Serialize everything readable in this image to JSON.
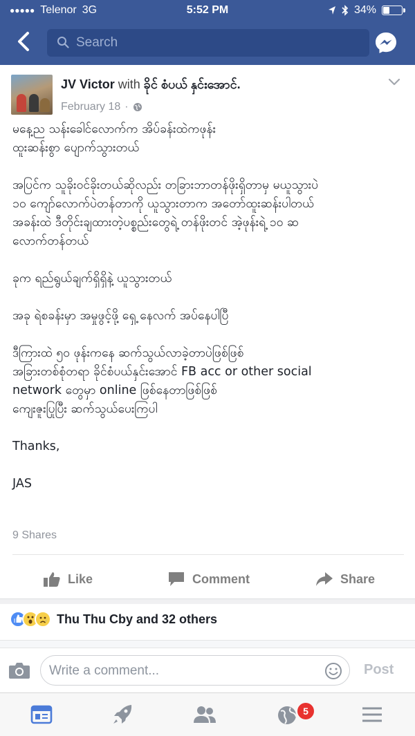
{
  "status_bar": {
    "signal_dots": "●●●●●",
    "carrier": "Telenor",
    "network": "3G",
    "time": "5:52 PM",
    "battery_percent": "34%",
    "battery_level": 0.34
  },
  "nav": {
    "search_placeholder": "Search"
  },
  "post": {
    "author": "JV Victor",
    "with_text": "with",
    "tagged": "ခိုင် စံပယ် နှင်းအောင်.",
    "date": "February 18",
    "date_separator": "·",
    "paragraphs": [
      [
        "မနေ့ည သန်းခေါင်လောက်က အိပ်ခန်းထဲကဖုန်း",
        "ထူးဆန်းစွာ ပျောက်သွားတယ်"
      ],
      [
        "အပြင်က သူခိုးဝင်ခိုးတယ်ဆိုလည်း တခြားဘာတန်ဖိုးရှိတာမှ မယူသွားပဲ",
        "၁၀ ကျော်လောက်ပဲတန်တာကို ယူသွားတာက အတော်ထူးဆန်းပါတယ်",
        "အခန်းထဲ ဒီတိုင်းချထားတဲ့ပစ္စည်းတွေရဲ့ တန်ဖိုးတင် အဲ့ဖုန်းရဲ့ ၁၀ ဆ",
        "လောက်တန်တယ်"
      ],
      [
        "ခုက ရည်ရွယ်ချက်ရှိရှိနဲ့ ယူသွားတယ်"
      ],
      [
        "အခု ရဲစခန်းမှာ အမှုဖွင့်ဖို့ ရှေ့ နေလက် အပ်နေပါပြီ"
      ],
      [
        "ဒီကြားထဲ ၅၀ ဖုန်းကနေ ဆက်သွယ်လာခဲ့တာပဲဖြစ်ဖြစ်",
        "အခြားတစ်စုံတရာ ခိုင်စံပယ်နှင်းအောင် FB acc or other social",
        "network တွေမှာ online ဖြစ်နေတာဖြစ်ဖြစ်",
        "ကျေးဇူးပြုပြီး ဆက်သွယ်ပေးကြပါ"
      ],
      [
        "Thanks,"
      ],
      [
        "JAS"
      ]
    ],
    "shares": "9 Shares",
    "actions": {
      "like": "Like",
      "comment": "Comment",
      "share": "Share"
    },
    "reactions_text": "Thu Thu Cby and 32 others"
  },
  "composer": {
    "placeholder": "Write a comment...",
    "post_label": "Post"
  },
  "tabbar": {
    "items": [
      "news-feed-icon",
      "rocket-icon",
      "friends-icon",
      "globe-icon",
      "menu-icon"
    ],
    "notification_count": "5"
  },
  "colors": {
    "brand_blue": "#3b5998",
    "search_bg": "#2d4a87",
    "badge_red": "#e8322f",
    "meta_gray": "#90949c"
  }
}
